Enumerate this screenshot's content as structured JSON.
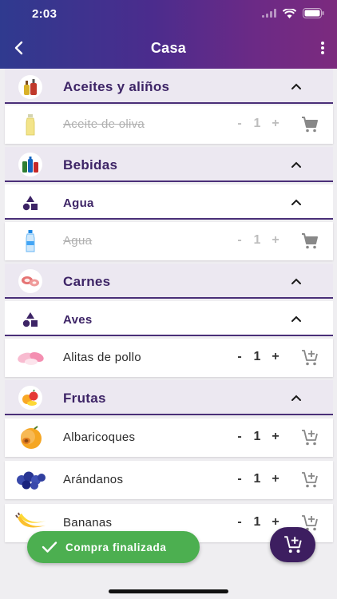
{
  "status": {
    "time": "2:03"
  },
  "header": {
    "title": "Casa"
  },
  "rows": {
    "aceites": {
      "label": "Aceites y aliños"
    },
    "aceite_oliva": {
      "label": "Aceite de oliva",
      "minus": "-",
      "quantity": "1",
      "plus": "+"
    },
    "bebidas": {
      "label": "Bebidas"
    },
    "agua_group": {
      "label": "Agua"
    },
    "agua_item": {
      "label": "Agua",
      "minus": "-",
      "quantity": "1",
      "plus": "+"
    },
    "carnes": {
      "label": "Carnes"
    },
    "aves": {
      "label": "Aves"
    },
    "alitas": {
      "label": "Alitas de pollo",
      "minus": "-",
      "quantity": "1",
      "plus": "+"
    },
    "frutas": {
      "label": "Frutas"
    },
    "albaricoques": {
      "label": "Albaricoques",
      "minus": "-",
      "quantity": "1",
      "plus": "+"
    },
    "arandanos": {
      "label": "Arándanos",
      "minus": "-",
      "quantity": "1",
      "plus": "+"
    },
    "bananas": {
      "label": "Bananas",
      "minus": "-",
      "quantity": "1",
      "plus": "+"
    }
  },
  "toast": {
    "text": "Compra finalizada"
  },
  "colors": {
    "accent": "#3d2466",
    "header_start": "#2f3a8f",
    "header_end": "#7c2a7e",
    "toast": "#4caf50",
    "fab": "#3d1e60"
  },
  "icons": {
    "aceites": "oil-bottles-icon",
    "aceite_oliva": "olive-oil-bottle-icon",
    "bebidas": "drinks-icon",
    "agua_group": "shapes-icon",
    "agua_item": "water-bottle-icon",
    "carnes": "meat-icon",
    "aves": "shapes-icon",
    "alitas": "chicken-wings-icon",
    "frutas": "fruits-icon",
    "albaricoques": "apricot-icon",
    "arandanos": "blueberries-icon",
    "bananas": "banana-icon"
  }
}
